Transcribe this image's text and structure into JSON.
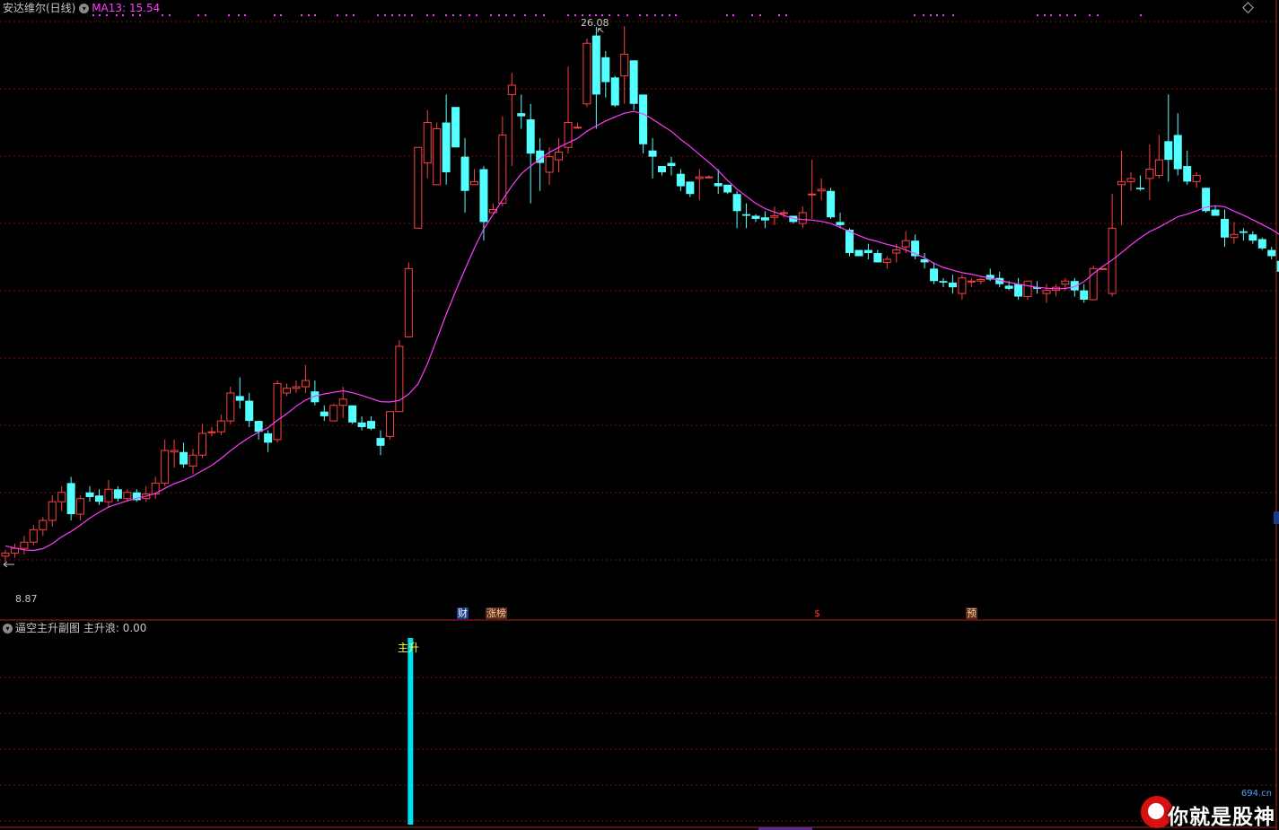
{
  "header": {
    "title": "安达维尔(日线)",
    "ma_label": "MA13: 15.54"
  },
  "annotations": {
    "high_label": "26.08",
    "low_label": "8.87"
  },
  "events": [
    {
      "label": "财",
      "style": "blue"
    },
    {
      "label": "涨榜",
      "style": "brown"
    },
    {
      "label": "$",
      "style": "red"
    },
    {
      "label": "预",
      "style": "brown"
    }
  ],
  "sub_panel": {
    "title": "逼空主升副图",
    "indicator": "主升浪: 0.00",
    "signal_label": "主升"
  },
  "watermark": {
    "text": "你就是股神",
    "site": "694.cn"
  },
  "colors": {
    "background": "#000000",
    "up": "#ff4040",
    "down": "#54ffff",
    "ma": "#ff3cff",
    "grid": "#7a1010",
    "signal": "#00e0f0"
  },
  "chart_data": {
    "type": "candlestick",
    "title": "安达维尔(日线)",
    "ma_period": 13,
    "ma_last": 15.54,
    "ylim": [
      7.6,
      27.0
    ],
    "high": 26.08,
    "low": 8.87,
    "candles": [
      [
        9.05,
        9.25,
        8.87,
        9.15
      ],
      [
        9.15,
        9.45,
        9.0,
        9.3
      ],
      [
        9.3,
        9.7,
        9.1,
        9.5
      ],
      [
        9.5,
        10.05,
        9.4,
        9.9
      ],
      [
        9.9,
        10.3,
        9.7,
        10.2
      ],
      [
        10.2,
        11.0,
        10.0,
        10.8
      ],
      [
        10.8,
        11.3,
        10.5,
        11.1
      ],
      [
        11.4,
        11.6,
        10.2,
        10.4
      ],
      [
        10.4,
        11.0,
        10.2,
        10.9
      ],
      [
        11.1,
        11.3,
        10.8,
        10.95
      ],
      [
        11.0,
        11.2,
        10.7,
        10.8
      ],
      [
        10.8,
        11.5,
        10.6,
        11.2
      ],
      [
        11.2,
        11.3,
        10.8,
        10.9
      ],
      [
        10.9,
        11.2,
        10.8,
        11.1
      ],
      [
        11.1,
        11.2,
        10.8,
        10.85
      ],
      [
        10.9,
        11.3,
        10.8,
        11.05
      ],
      [
        11.05,
        11.6,
        10.9,
        11.4
      ],
      [
        11.4,
        12.8,
        11.3,
        12.45
      ],
      [
        12.4,
        12.8,
        11.9,
        12.45
      ],
      [
        12.4,
        12.7,
        11.9,
        12.0
      ],
      [
        11.95,
        12.5,
        11.7,
        12.3
      ],
      [
        12.3,
        13.3,
        12.2,
        13.0
      ],
      [
        13.05,
        13.2,
        12.9,
        13.05
      ],
      [
        13.05,
        13.6,
        12.95,
        13.4
      ],
      [
        13.4,
        14.5,
        13.3,
        14.3
      ],
      [
        14.2,
        14.8,
        13.8,
        14.05
      ],
      [
        14.05,
        14.3,
        13.2,
        13.4
      ],
      [
        13.4,
        13.4,
        12.8,
        13.05
      ],
      [
        13.0,
        13.1,
        12.4,
        12.7
      ],
      [
        12.8,
        14.7,
        12.7,
        14.6
      ],
      [
        14.3,
        14.6,
        14.2,
        14.45
      ],
      [
        14.45,
        14.7,
        14.3,
        14.5
      ],
      [
        14.5,
        15.2,
        14.3,
        14.7
      ],
      [
        14.35,
        14.7,
        13.9,
        14.0
      ],
      [
        13.7,
        13.9,
        13.4,
        13.55
      ],
      [
        13.4,
        13.95,
        13.4,
        13.9
      ],
      [
        13.9,
        14.5,
        13.5,
        14.1
      ],
      [
        13.9,
        13.9,
        13.3,
        13.35
      ],
      [
        13.35,
        13.55,
        13.1,
        13.2
      ],
      [
        13.4,
        13.55,
        13.1,
        13.15
      ],
      [
        12.85,
        13.1,
        12.3,
        12.6
      ],
      [
        12.9,
        13.7,
        12.8,
        13.7
      ],
      [
        13.7,
        16.0,
        13.7,
        15.8
      ],
      [
        16.1,
        18.5,
        16.1,
        18.3
      ],
      [
        19.6,
        22.1,
        19.6,
        22.2
      ],
      [
        21.7,
        23.4,
        21.2,
        23.0
      ],
      [
        21.0,
        23.0,
        21.0,
        22.8
      ],
      [
        23.0,
        23.9,
        21.0,
        21.4
      ],
      [
        23.5,
        23.5,
        22.4,
        22.2
      ],
      [
        21.9,
        22.5,
        20.1,
        20.8
      ],
      [
        21.0,
        21.5,
        21.1,
        21.1
      ],
      [
        21.5,
        21.6,
        19.2,
        19.8
      ],
      [
        20.1,
        20.4,
        20.1,
        20.2
      ],
      [
        20.4,
        23.2,
        20.3,
        22.6
      ],
      [
        23.9,
        24.6,
        21.6,
        24.2
      ],
      [
        23.3,
        23.9,
        22.8,
        23.2
      ],
      [
        23.1,
        23.6,
        20.4,
        22.0
      ],
      [
        22.1,
        22.5,
        20.8,
        21.7
      ],
      [
        21.4,
        22.2,
        21.0,
        21.9
      ],
      [
        21.8,
        22.5,
        21.4,
        22.05
      ],
      [
        22.2,
        24.8,
        22.0,
        23.0
      ],
      [
        22.85,
        23.0,
        22.8,
        22.85
      ],
      [
        23.6,
        25.7,
        23.5,
        25.55
      ],
      [
        25.8,
        26.08,
        22.8,
        23.9
      ],
      [
        25.1,
        25.3,
        23.8,
        24.3
      ],
      [
        24.45,
        24.5,
        23.5,
        23.55
      ],
      [
        24.5,
        26.1,
        23.6,
        25.2
      ],
      [
        25.0,
        25.0,
        23.4,
        23.6
      ],
      [
        23.9,
        23.9,
        22.0,
        22.3
      ],
      [
        22.1,
        22.5,
        21.2,
        21.9
      ],
      [
        21.6,
        21.6,
        21.3,
        21.4
      ],
      [
        21.7,
        21.9,
        21.3,
        21.6
      ],
      [
        21.35,
        21.5,
        20.8,
        20.95
      ],
      [
        21.1,
        21.1,
        20.6,
        20.7
      ],
      [
        21.2,
        21.5,
        20.5,
        21.25
      ],
      [
        21.25,
        21.3,
        21.2,
        21.25
      ],
      [
        21.05,
        21.5,
        20.7,
        20.95
      ],
      [
        21.0,
        21.0,
        20.7,
        20.75
      ],
      [
        20.7,
        20.8,
        19.6,
        20.15
      ],
      [
        20.05,
        20.4,
        19.6,
        20.0
      ],
      [
        20.0,
        20.05,
        19.8,
        19.9
      ],
      [
        19.95,
        20.15,
        19.6,
        19.85
      ],
      [
        19.95,
        20.3,
        19.7,
        20.0
      ],
      [
        20.1,
        20.2,
        19.95,
        20.1
      ],
      [
        20.0,
        20.0,
        19.75,
        19.8
      ],
      [
        19.75,
        20.3,
        19.6,
        20.1
      ],
      [
        20.7,
        21.8,
        19.9,
        20.7
      ],
      [
        20.8,
        21.2,
        20.5,
        20.85
      ],
      [
        20.8,
        20.9,
        19.9,
        19.95
      ],
      [
        19.8,
        20.1,
        19.6,
        19.7
      ],
      [
        19.55,
        19.6,
        18.7,
        18.8
      ],
      [
        18.9,
        18.9,
        18.7,
        18.7
      ],
      [
        18.9,
        19.1,
        18.6,
        18.8
      ],
      [
        18.8,
        18.9,
        18.5,
        18.5
      ],
      [
        18.5,
        18.7,
        18.3,
        18.6
      ],
      [
        18.8,
        19.1,
        18.5,
        18.9
      ],
      [
        19.0,
        19.5,
        18.8,
        19.2
      ],
      [
        19.2,
        19.4,
        18.6,
        18.7
      ],
      [
        18.6,
        18.8,
        18.3,
        18.5
      ],
      [
        18.3,
        18.5,
        17.8,
        17.9
      ],
      [
        17.9,
        18.0,
        17.7,
        17.85
      ],
      [
        17.85,
        18.1,
        17.5,
        17.7
      ],
      [
        17.5,
        18.1,
        17.3,
        18.0
      ],
      [
        17.9,
        18.0,
        17.7,
        17.9
      ],
      [
        17.9,
        18.0,
        17.8,
        17.95
      ],
      [
        18.1,
        18.3,
        17.9,
        17.95
      ],
      [
        18.0,
        18.2,
        17.7,
        17.8
      ],
      [
        17.75,
        17.9,
        17.6,
        17.65
      ],
      [
        17.8,
        18.0,
        17.3,
        17.4
      ],
      [
        17.4,
        17.9,
        17.3,
        17.9
      ],
      [
        17.7,
        17.9,
        17.5,
        17.65
      ],
      [
        17.5,
        17.8,
        17.2,
        17.6
      ],
      [
        17.6,
        17.8,
        17.4,
        17.7
      ],
      [
        17.8,
        18.0,
        17.6,
        17.9
      ],
      [
        17.9,
        18.0,
        17.4,
        17.6
      ],
      [
        17.6,
        17.8,
        17.2,
        17.3
      ],
      [
        17.3,
        18.4,
        17.3,
        18.3
      ],
      [
        18.3,
        18.3,
        18.3,
        18.3
      ],
      [
        17.5,
        20.7,
        17.4,
        19.6
      ],
      [
        21.0,
        22.1,
        19.7,
        21.1
      ],
      [
        21.1,
        21.4,
        20.8,
        21.2
      ],
      [
        20.9,
        21.3,
        20.8,
        20.85
      ],
      [
        21.2,
        22.3,
        20.5,
        21.5
      ],
      [
        21.3,
        22.6,
        21.2,
        21.8
      ],
      [
        22.4,
        23.9,
        21.1,
        21.8
      ],
      [
        22.6,
        23.3,
        21.3,
        21.5
      ],
      [
        21.6,
        22.1,
        21.0,
        21.1
      ],
      [
        21.1,
        21.4,
        20.9,
        21.3
      ],
      [
        20.9,
        20.9,
        20.1,
        20.15
      ],
      [
        20.2,
        20.3,
        20.0,
        20.0
      ],
      [
        19.9,
        20.2,
        19.0,
        19.3
      ],
      [
        19.3,
        19.8,
        19.1,
        19.4
      ],
      [
        19.5,
        19.6,
        19.2,
        19.45
      ],
      [
        19.4,
        19.5,
        19.1,
        19.2
      ],
      [
        19.25,
        19.3,
        18.9,
        18.95
      ],
      [
        18.9,
        19.0,
        18.6,
        18.7
      ],
      [
        18.55,
        18.6,
        18.1,
        18.2
      ],
      [
        18.3,
        18.4,
        18.1,
        18.35
      ],
      [
        18.3,
        18.5,
        18.0,
        18.25
      ],
      [
        18.1,
        18.2,
        17.6,
        17.65
      ],
      [
        17.65,
        17.8,
        17.55,
        17.7
      ]
    ],
    "ma13": [
      9.38,
      9.31,
      9.25,
      9.23,
      9.29,
      9.45,
      9.67,
      9.84,
      10.05,
      10.27,
      10.46,
      10.63,
      10.73,
      10.83,
      10.91,
      10.98,
      11.07,
      11.23,
      11.38,
      11.49,
      11.63,
      11.8,
      11.97,
      12.19,
      12.44,
      12.67,
      12.87,
      13.04,
      13.18,
      13.42,
      13.63,
      13.87,
      14.07,
      14.2,
      14.27,
      14.32,
      14.37,
      14.31,
      14.22,
      14.12,
      14.02,
      14.01,
      14.06,
      14.26,
      14.59,
      15.23,
      16.03,
      16.82,
      17.57,
      18.27,
      18.96,
      19.57,
      20.04,
      20.51,
      20.96,
      21.35,
      21.6,
      21.83,
      22.04,
      22.2,
      22.35,
      22.49,
      22.72,
      22.89,
      23.05,
      23.18,
      23.3,
      23.36,
      23.28,
      23.11,
      22.91,
      22.72,
      22.46,
      22.23,
      21.97,
      21.72,
      21.45,
      21.14,
      20.86,
      20.63,
      20.4,
      20.23,
      20.12,
      20.01,
      19.91,
      19.88,
      19.86,
      19.82,
      19.75,
      19.63,
      19.49,
      19.36,
      19.25,
      19.17,
      19.08,
      19.01,
      18.9,
      18.78,
      18.65,
      18.47,
      18.34,
      18.25,
      18.17,
      18.12,
      18.05,
      17.99,
      17.92,
      17.86,
      17.8,
      17.75,
      17.7,
      17.67,
      17.65,
      17.66,
      17.72,
      17.88,
      18.14,
      18.37,
      18.58,
      18.81,
      19.06,
      19.29,
      19.49,
      19.63,
      19.8,
      19.97,
      20.05,
      20.16,
      20.28,
      20.32,
      20.29,
      20.15,
      20.02,
      19.87,
      19.72,
      19.56,
      19.37,
      19.15,
      18.95,
      18.74
    ],
    "sub_values": {
      "indicator_name": "主升浪",
      "current": 0.0,
      "signal_index": 43
    }
  }
}
